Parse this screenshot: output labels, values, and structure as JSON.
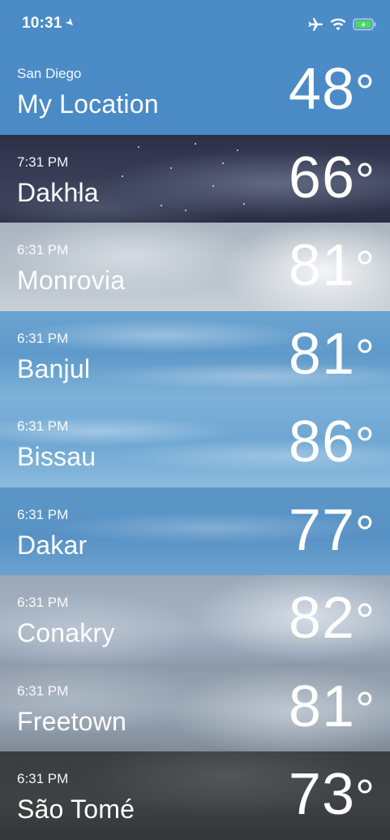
{
  "status_bar": {
    "time": "10:31",
    "location_arrow": "location-arrow-icon",
    "icons": [
      "airplane-icon",
      "wifi-icon",
      "battery-charging-icon"
    ],
    "battery_color": "#4cd964"
  },
  "cities": [
    {
      "sub_label": "San Diego",
      "name": "My Location",
      "temp": "48",
      "deg": "°",
      "theme": "location"
    },
    {
      "sub_label": "7:31 PM",
      "name": "Dakhla",
      "temp": "66",
      "deg": "°",
      "theme": "night"
    },
    {
      "sub_label": "6:31 PM",
      "name": "Monrovia",
      "temp": "81",
      "deg": "°",
      "theme": "cloudy-light"
    },
    {
      "sub_label": "6:31 PM",
      "name": "Banjul",
      "temp": "81",
      "deg": "°",
      "theme": "sky1"
    },
    {
      "sub_label": "6:31 PM",
      "name": "Bissau",
      "temp": "86",
      "deg": "°",
      "theme": "sky2"
    },
    {
      "sub_label": "6:31 PM",
      "name": "Dakar",
      "temp": "77",
      "deg": "°",
      "theme": "sky3"
    },
    {
      "sub_label": "6:31 PM",
      "name": "Conakry",
      "temp": "82",
      "deg": "°",
      "theme": "cloudy-mid"
    },
    {
      "sub_label": "6:31 PM",
      "name": "Freetown",
      "temp": "81",
      "deg": "°",
      "theme": "cloudy-dark"
    },
    {
      "sub_label": "6:31 PM",
      "name": "São Tomé",
      "temp": "73",
      "deg": "°",
      "theme": "storm"
    }
  ]
}
